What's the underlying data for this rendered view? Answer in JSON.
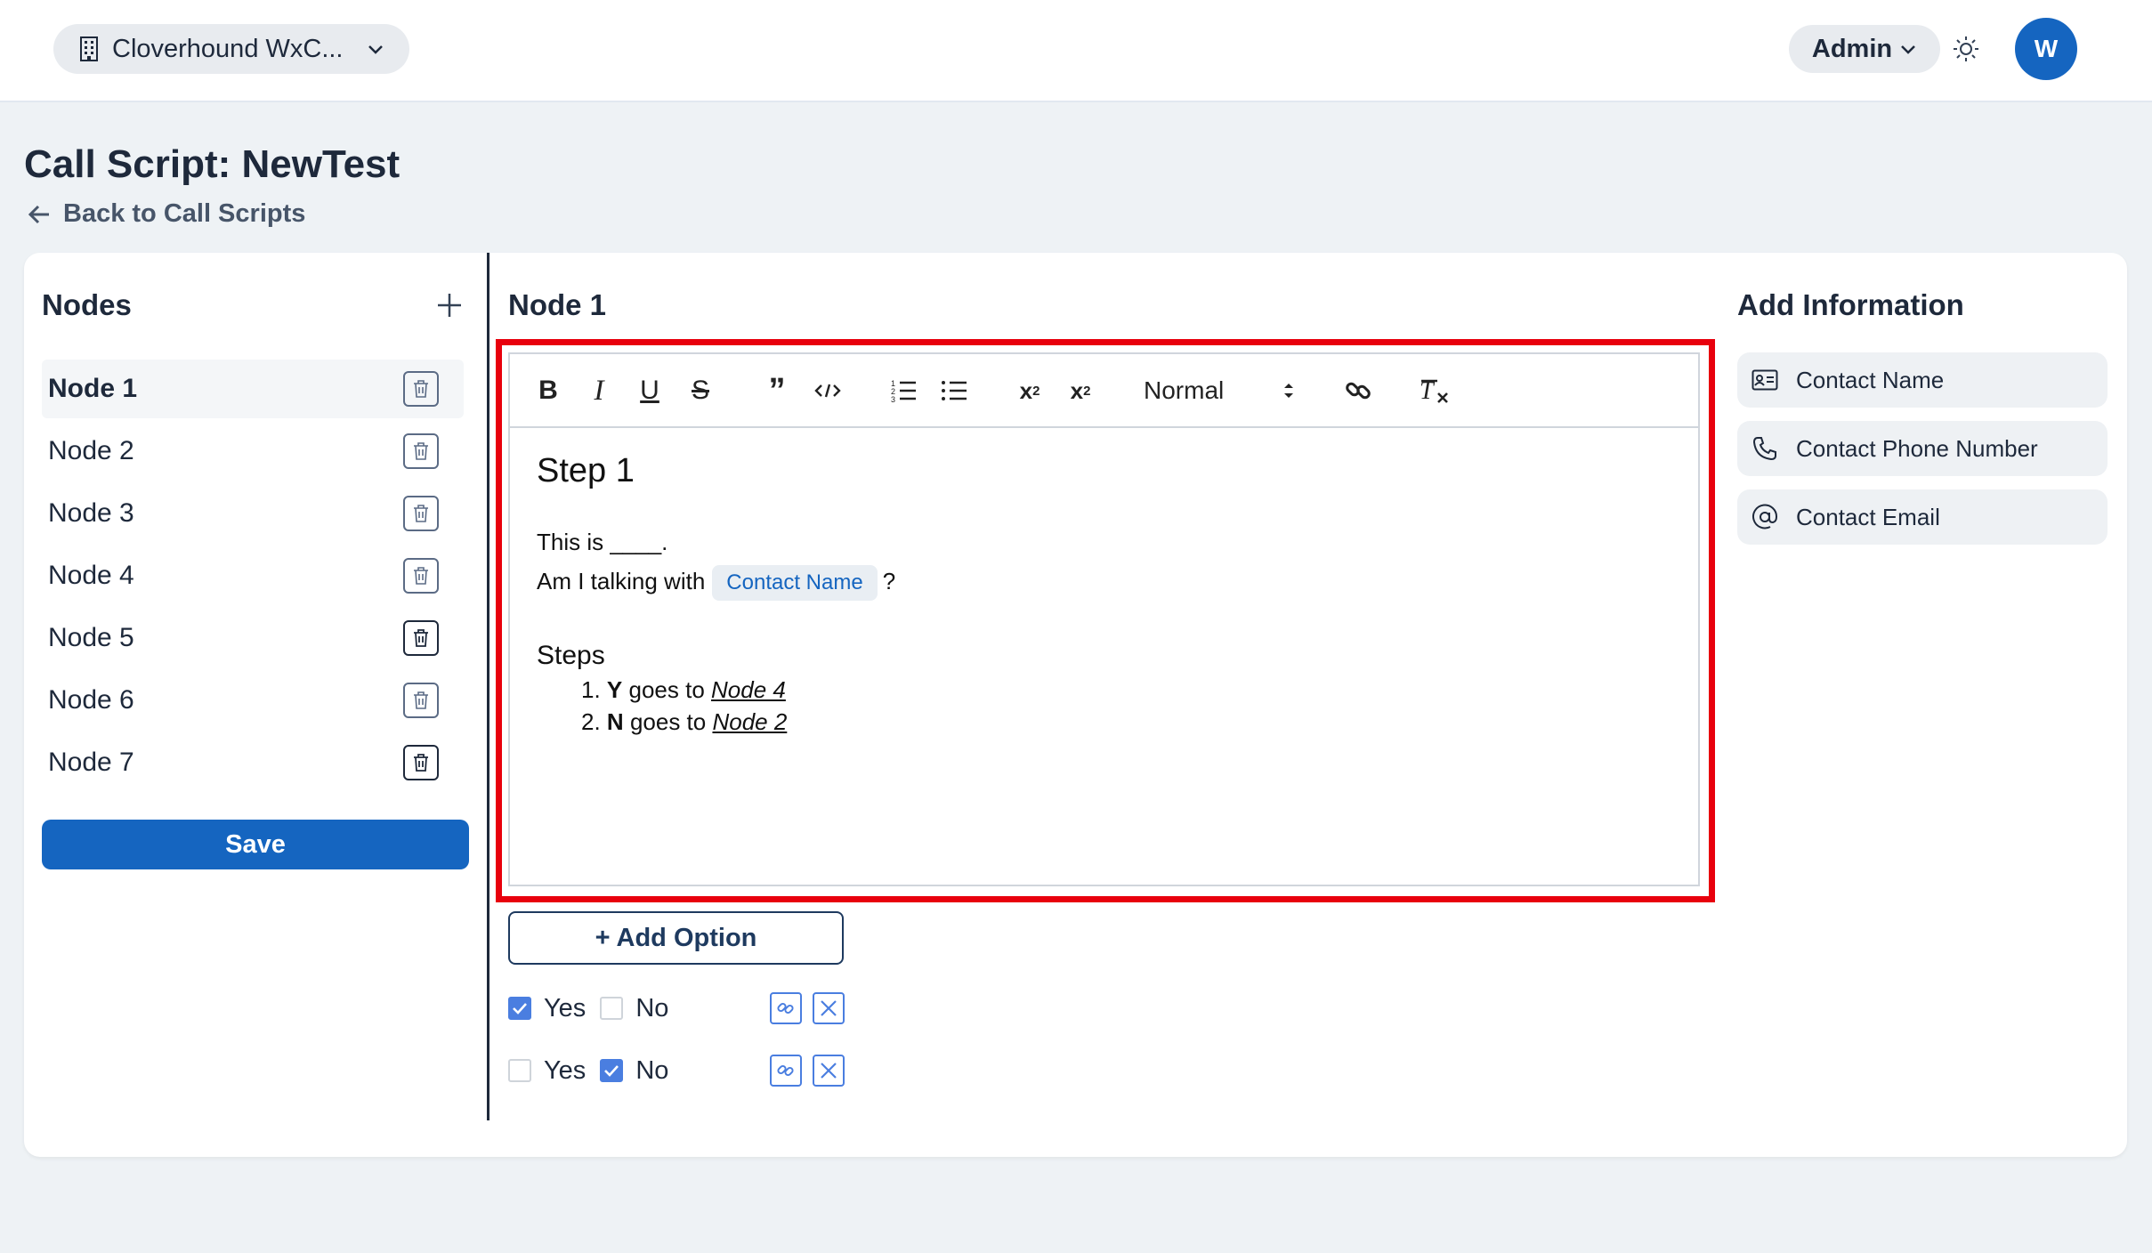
{
  "topbar": {
    "org_name": "Cloverhound WxC...",
    "role": "Admin",
    "avatar_initial": "W"
  },
  "page": {
    "title": "Call Script: NewTest",
    "back_label": "Back to Call Scripts"
  },
  "nodes_panel": {
    "title": "Nodes",
    "items": [
      {
        "label": "Node 1"
      },
      {
        "label": "Node 2"
      },
      {
        "label": "Node 3"
      },
      {
        "label": "Node 4"
      },
      {
        "label": "Node 5"
      },
      {
        "label": "Node 6"
      },
      {
        "label": "Node 7"
      }
    ],
    "save_label": "Save"
  },
  "editor": {
    "node_title": "Node 1",
    "format_value": "Normal",
    "content": {
      "heading": "Step 1",
      "line1": "This is ____.",
      "line2_prefix": "Am I talking with",
      "line2_chip": "Contact Name",
      "line2_suffix": "?",
      "steps_title": "Steps",
      "steps": [
        {
          "num": "1.",
          "key": "Y",
          "mid": "goes to",
          "target": "Node 4"
        },
        {
          "num": "2.",
          "key": "N",
          "mid": "goes to",
          "target": "Node 2"
        }
      ]
    }
  },
  "options": {
    "add_label": "+ Add Option",
    "rows": [
      {
        "yes_label": "Yes",
        "no_label": "No",
        "yes": true,
        "no": false
      },
      {
        "yes_label": "Yes",
        "no_label": "No",
        "yes": false,
        "no": true
      }
    ]
  },
  "add_information": {
    "title": "Add Information",
    "items": [
      {
        "label": "Contact Name",
        "icon": "contact-card-icon"
      },
      {
        "label": "Contact Phone Number",
        "icon": "phone-icon"
      },
      {
        "label": "Contact Email",
        "icon": "at-sign-icon"
      }
    ]
  },
  "colors": {
    "primary": "#1565c0",
    "highlight": "#e8000d",
    "checkbox": "#4a7ee0"
  }
}
